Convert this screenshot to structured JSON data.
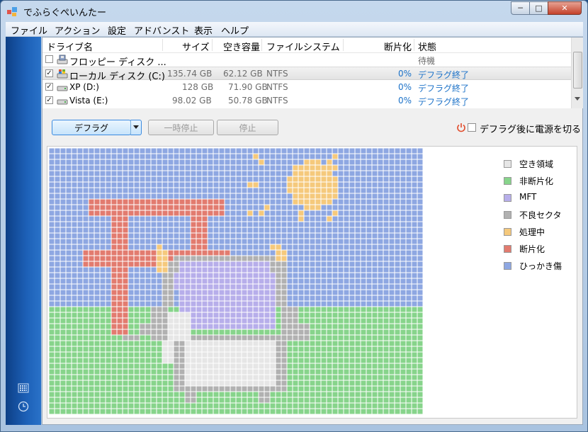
{
  "window": {
    "title": "でふらぐぺいんたー"
  },
  "titlebar_buttons": {
    "minimize": "─",
    "maximize": "□",
    "close": "✕"
  },
  "menu": [
    "ファイル",
    "アクション",
    "設定",
    "アドバンスト",
    "表示",
    "ヘルプ"
  ],
  "table": {
    "headers": {
      "name": "ドライブ名",
      "size": "サイズ",
      "free": "空き容量",
      "fs": "ファイルシステム",
      "frag": "断片化",
      "status": "状態"
    },
    "rows": [
      {
        "checked": false,
        "icon": "floppy-drive-icon",
        "name": "フロッピー ディスク ...",
        "size": "",
        "free": "",
        "fs": "",
        "frag": "",
        "status": "待機"
      },
      {
        "checked": true,
        "icon": "windows-drive-icon",
        "name": "ローカル ディスク (C:)",
        "size": "135.74 GB",
        "free": "62.12 GB",
        "fs": "NTFS",
        "frag": "0%",
        "status": "デフラグ終了"
      },
      {
        "checked": true,
        "icon": "hard-drive-icon",
        "name": "XP (D:)",
        "size": "128 GB",
        "free": "71.90 GB",
        "fs": "NTFS",
        "frag": "0%",
        "status": "デフラグ終了"
      },
      {
        "checked": true,
        "icon": "hard-drive-icon",
        "name": "Vista (E:)",
        "size": "98.02 GB",
        "free": "50.78 GB",
        "fs": "NTFS",
        "frag": "0%",
        "status": "デフラグ終了"
      }
    ]
  },
  "toolbar": {
    "defrag_label": "デフラグ",
    "pause_label": "一時停止",
    "stop_label": "停止",
    "power_label": "デフラグ後に電源を切る",
    "power_checked": false
  },
  "legend": [
    {
      "label": "空き領域",
      "color": "#e6e6e6"
    },
    {
      "label": "非断片化",
      "color": "#87d48b"
    },
    {
      "label": "MFT",
      "color": "#b7aeea"
    },
    {
      "label": "不良セクタ",
      "color": "#b1b1b1"
    },
    {
      "label": "処理中",
      "color": "#f5c97c"
    },
    {
      "label": "断片化",
      "color": "#e27b6f"
    },
    {
      "label": "ひっかき傷",
      "color": "#8ea7e2"
    }
  ],
  "colors": {
    "accent": "#1c72c8",
    "sky": "#8ea7e2",
    "ground": "#87d48b"
  }
}
